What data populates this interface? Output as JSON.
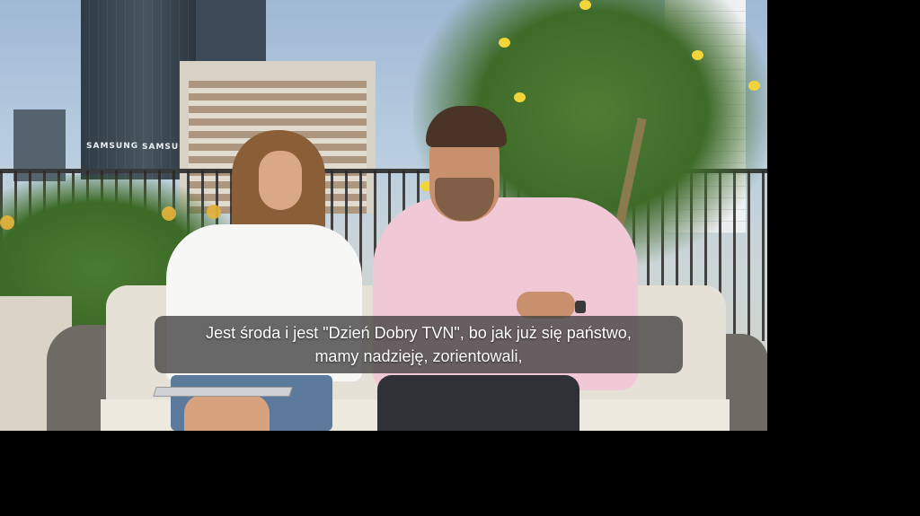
{
  "video": {
    "scene": {
      "sign_left": "SAMSUNG",
      "sign_right": "SAMSUNG"
    },
    "subtitles": {
      "line1": "Jest środa i jest \"Dzień Dobry TVN\", bo jak już się państwo,",
      "line2": "mamy nadzieję, zorientowali,"
    }
  },
  "colors": {
    "letterbox": "#000000",
    "subtitle_bg": "#404040",
    "subtitle_text": "#ffffff"
  }
}
